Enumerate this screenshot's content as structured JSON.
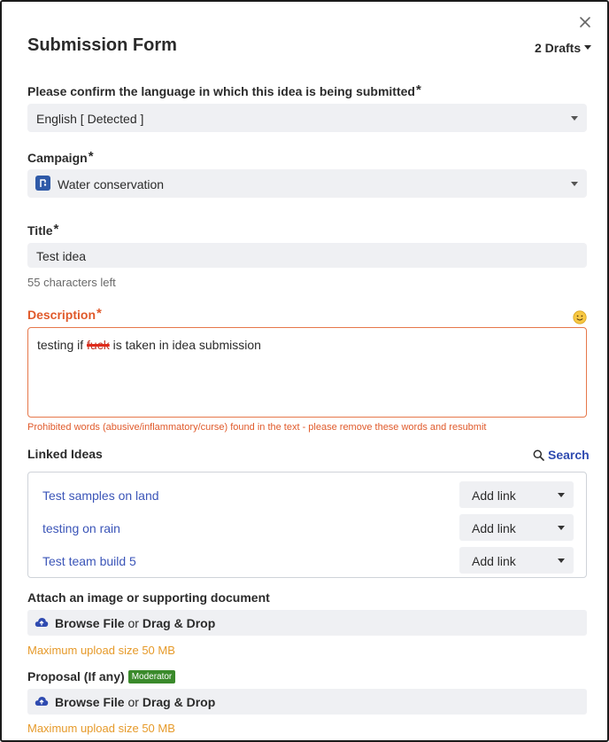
{
  "form": {
    "title": "Submission Form",
    "drafts_label": "2 Drafts"
  },
  "language": {
    "label": "Please confirm the language in which this idea is being submitted",
    "required_mark": "*",
    "value": "English [ Detected ]"
  },
  "campaign": {
    "label": "Campaign",
    "required_mark": "*",
    "value": "Water conservation",
    "icon": "campaign-icon"
  },
  "title_field": {
    "label": "Title",
    "required_mark": "*",
    "value": "Test idea",
    "hint": "55 characters left"
  },
  "description": {
    "label": "Description",
    "required_mark": "*",
    "text_before": "testing if ",
    "flagged_word": "fuck",
    "text_after": " is taken in idea submission",
    "error": "Prohibited words (abusive/inflammatory/curse) found in the text - please remove these words and resubmit"
  },
  "linked_ideas": {
    "label": "Linked Ideas",
    "search_label": "Search",
    "items": [
      {
        "name": "Test samples on land",
        "action": "Add link"
      },
      {
        "name": "testing on rain",
        "action": "Add link"
      },
      {
        "name": "Test team build 5",
        "action": "Add link"
      }
    ]
  },
  "attachment": {
    "label": "Attach an image or supporting document",
    "browse": "Browse File",
    "or": "or",
    "drag": "Drag & Drop",
    "max": "Maximum upload size 50 MB"
  },
  "proposal": {
    "label": "Proposal (If any)",
    "badge": "Moderator",
    "browse": "Browse File",
    "or": "or",
    "drag": "Drag & Drop",
    "max": "Maximum upload size 50 MB"
  },
  "colors": {
    "accent_blue": "#2f4bb0",
    "error_orange": "#e05a2b",
    "warning_amber": "#e69a2a",
    "badge_green": "#3a8a2b"
  }
}
